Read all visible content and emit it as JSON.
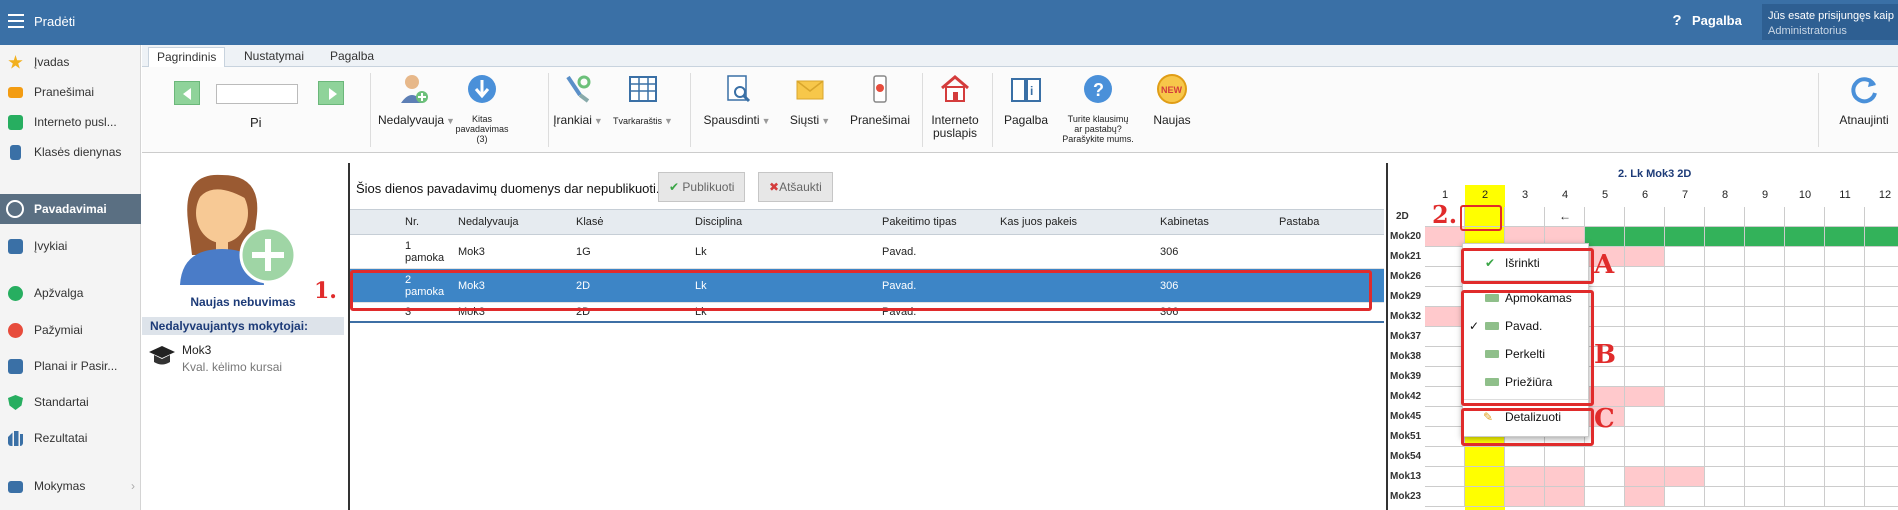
{
  "topbar": {
    "title": "Pradėti",
    "help": "Pagalba",
    "user_line1": "Jūs esate prisijungęs kaip",
    "user_line2": "Administratorius"
  },
  "sidebar": {
    "items": [
      {
        "label": "Įvadas",
        "color": "#f2b01e",
        "icon": "star-icon"
      },
      {
        "label": "Pranešimai",
        "color": "#f39c12",
        "icon": "envelope-icon"
      },
      {
        "label": "Interneto pusl...",
        "color": "#2ecc71",
        "icon": "house-icon"
      },
      {
        "label": "Klasės dienynas",
        "color": "#3a70a6",
        "icon": "book-icon"
      },
      {
        "label": "Pavadavimai",
        "color": "#ffffff",
        "icon": "person-icon"
      },
      {
        "label": "Įvykiai",
        "color": "#3a70a6",
        "icon": "calendar-icon"
      },
      {
        "label": "Apžvalga",
        "color": "#27ae60",
        "icon": "check-circle-icon"
      },
      {
        "label": "Pažymiai",
        "color": "#e74c3c",
        "icon": "grades-icon"
      },
      {
        "label": "Planai ir Pasir...",
        "color": "#3a70a6",
        "icon": "plan-icon"
      },
      {
        "label": "Standartai",
        "color": "#27ae60",
        "icon": "shield-icon"
      },
      {
        "label": "Rezultatai",
        "color": "#3a70a6",
        "icon": "bar-chart-icon"
      },
      {
        "label": "Mokymas",
        "color": "#3a70a6",
        "icon": "monitor-icon"
      }
    ]
  },
  "ribbon": {
    "tabs": [
      "Pagrindinis",
      "Nustatymai",
      "Pagalba"
    ],
    "period_label": "Pi",
    "nedalyvauja": "Nedalyvauja",
    "kitas_1": "Kitas",
    "kitas_2": "pavadavimas",
    "kitas_3": "(3)",
    "irankiai": "Įrankiai",
    "tvarkarastis": "Tvarkaraštis",
    "spausdinti": "Spausdinti",
    "siusti": "Siųsti",
    "pranesimai": "Pranešimai",
    "internetas_1": "Interneto",
    "internetas_2": "puslapis",
    "pagalba": "Pagalba",
    "klausimai_1": "Turite klausimų",
    "klausimai_2": "ar pastabų?",
    "klausimai_3": "Parašykite mums.",
    "naujas": "Naujas",
    "new_badge": "NEW",
    "atnaujinti": "Atnaujinti"
  },
  "left": {
    "caption": "Naujas nebuvimas",
    "header": "Nedalyvaujantys mokytojai:",
    "teacher": "Mok3",
    "teacher_sub": "Kval. kėlimo kursai"
  },
  "main": {
    "notice": "Šios dienos pavadavimų duomenys dar nepublikuoti.",
    "publish": "Publikuoti",
    "cancel": "Atšaukti",
    "columns": [
      "Nr.",
      "Nedalyvauja",
      "Klasė",
      "Disciplina",
      "Pakeitimo tipas",
      "Kas juos pakeis",
      "Kabinetas",
      "Pastaba"
    ],
    "rows": [
      {
        "nr1": "1",
        "nr2": "pamoka",
        "teacher": "Mok3",
        "cls": "1G",
        "disc": "Lk",
        "type": "Pavad.",
        "who": "",
        "room": "306",
        "note": ""
      },
      {
        "nr1": "2",
        "nr2": "pamoka",
        "teacher": "Mok3",
        "cls": "2D",
        "disc": "Lk",
        "type": "Pavad.",
        "who": "",
        "room": "306",
        "note": ""
      },
      {
        "nr1": "3",
        "nr2": "",
        "teacher": "Mok3",
        "cls": "2D",
        "disc": "Lk",
        "type": "Pavad.",
        "who": "",
        "room": "306",
        "note": ""
      }
    ]
  },
  "annotations": {
    "one": "1.",
    "two": "2.",
    "a": "A",
    "b": "B",
    "c": "C"
  },
  "grid": {
    "title": "2. Lk Mok3 2D",
    "class_label": "2D",
    "columns": [
      "1",
      "2",
      "3",
      "4",
      "5",
      "6",
      "7",
      "8",
      "9",
      "10",
      "11",
      "12"
    ],
    "arrow": "←",
    "rows": [
      "Mok20",
      "Mok21",
      "Mok26",
      "Mok29",
      "Mok32",
      "Mok37",
      "Mok38",
      "Mok39",
      "Mok42",
      "Mok45",
      "Mok51",
      "Mok54",
      "Mok13",
      "Mok23"
    ]
  },
  "context_menu": {
    "select": "Išrinkti",
    "opt1": "Apmokamas",
    "opt2": "Pavad.",
    "opt3": "Perkelti",
    "opt4": "Priežiūra",
    "detail": "Detalizuoti"
  }
}
